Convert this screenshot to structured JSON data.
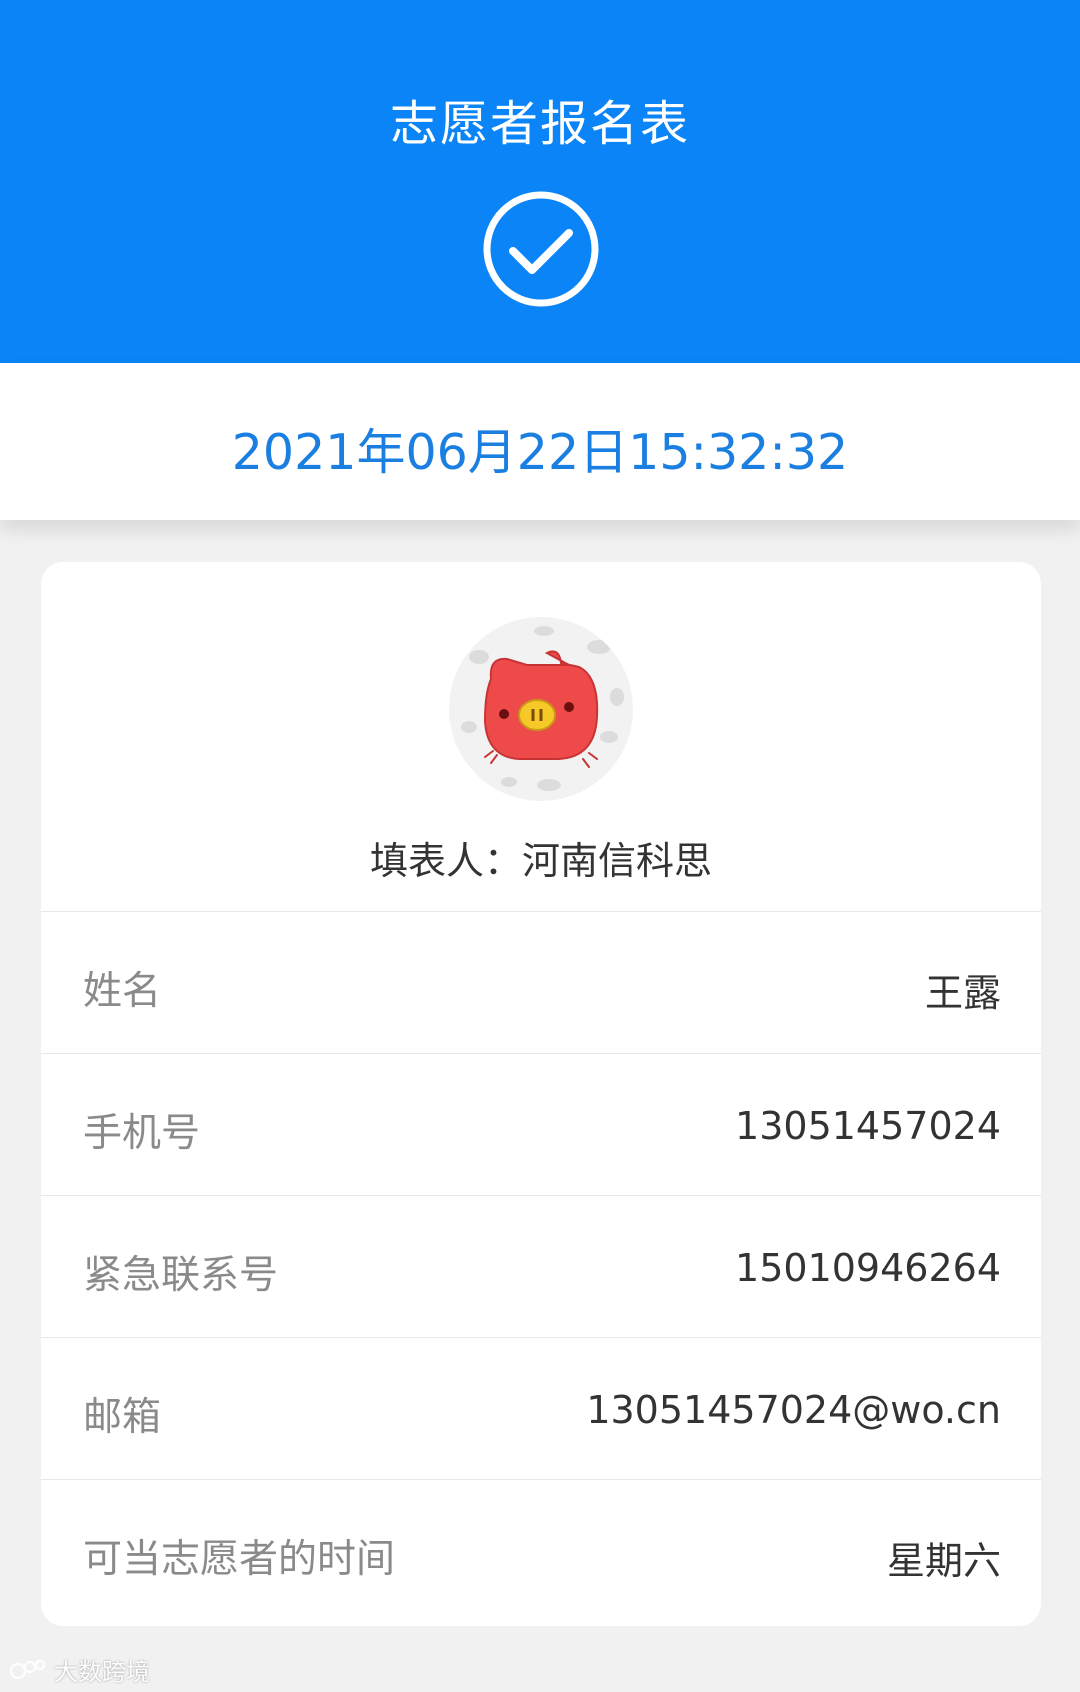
{
  "header": {
    "title": "志愿者报名表",
    "status_icon": "check-circle-icon",
    "color": "#0a84f6"
  },
  "submission": {
    "datetime": "2021年06月22日15:32:32",
    "color": "#1a7fe0"
  },
  "profile": {
    "avatar_icon": "red-pig-avatar",
    "filler_label": "填表人：河南信科思"
  },
  "fields": [
    {
      "label": "姓名",
      "value": "王露"
    },
    {
      "label": "手机号",
      "value": "13051457024"
    },
    {
      "label": "紧急联系号",
      "value": "15010946264"
    },
    {
      "label": "邮箱",
      "value": "13051457024@wo.cn"
    },
    {
      "label": "可当志愿者的时间",
      "value": "星期六"
    }
  ],
  "watermark": {
    "text": "大数跨境"
  }
}
